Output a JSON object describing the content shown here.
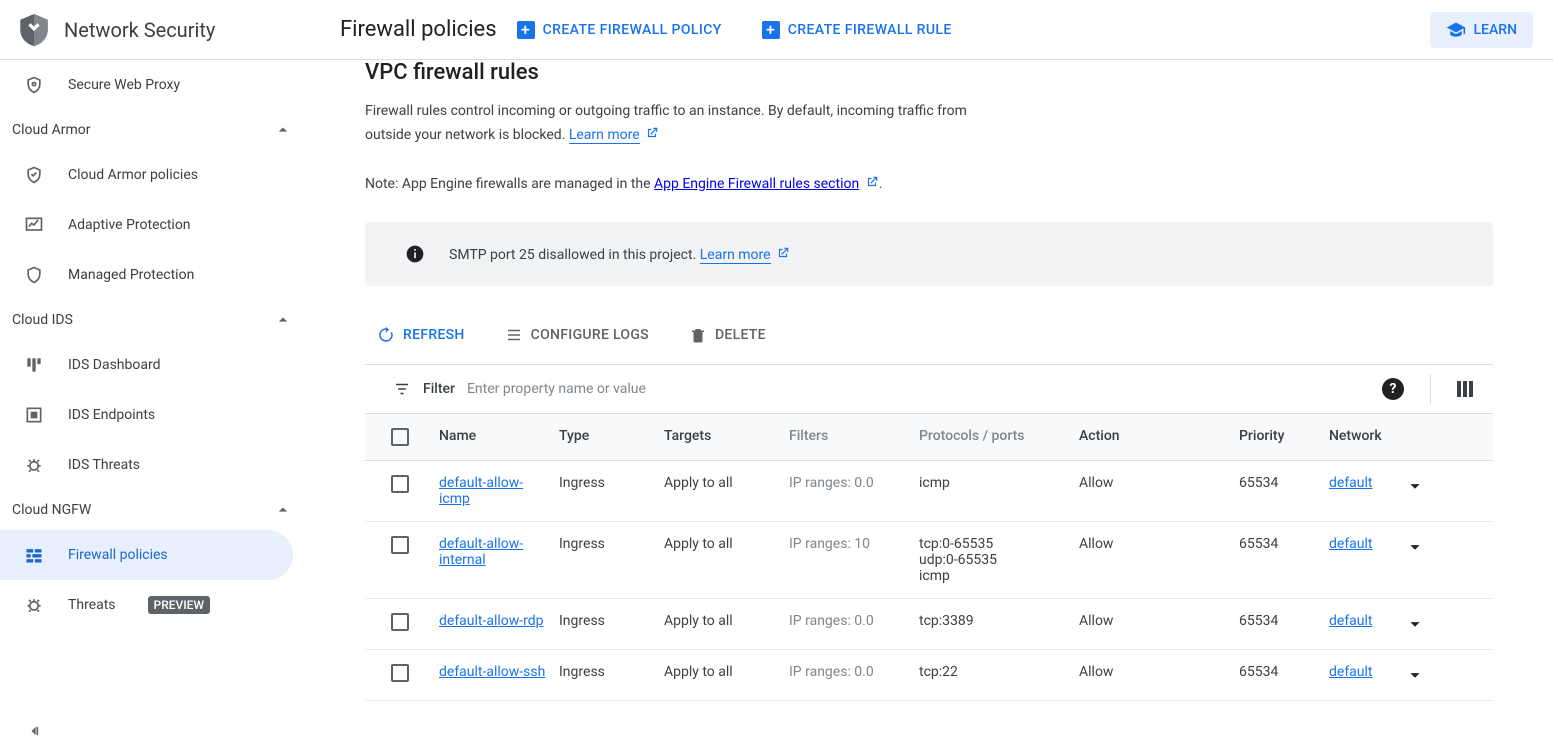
{
  "brand": {
    "title": "Network Security"
  },
  "header": {
    "page_title": "Firewall policies",
    "create_policy": "CREATE FIREWALL POLICY",
    "create_rule": "CREATE FIREWALL RULE",
    "learn": "LEARN"
  },
  "sidebar": {
    "item_proxy": "Secure Web Proxy",
    "group_armor": "Cloud Armor",
    "item_armor_policies": "Cloud Armor policies",
    "item_adaptive": "Adaptive Protection",
    "item_managed": "Managed Protection",
    "group_ids": "Cloud IDS",
    "item_ids_dashboard": "IDS Dashboard",
    "item_ids_endpoints": "IDS Endpoints",
    "item_ids_threats": "IDS Threats",
    "group_ngfw": "Cloud NGFW",
    "item_firewall_policies": "Firewall policies",
    "item_threats": "Threats",
    "badge_preview": "PREVIEW"
  },
  "main": {
    "section_title": "VPC firewall rules",
    "desc": "Firewall rules control incoming or outgoing traffic to an instance. By default, incoming traffic from outside your network is blocked. ",
    "learn_more": "Learn more",
    "note_prefix": "Note: App Engine firewalls are managed in the ",
    "note_link": "App Engine Firewall rules section",
    "smtp_msg": "SMTP port 25 disallowed in this project. ",
    "refresh": "REFRESH",
    "configure_logs": "CONFIGURE LOGS",
    "delete": "DELETE",
    "filter_label": "Filter",
    "filter_placeholder": "Enter property name or value"
  },
  "columns": {
    "name": "Name",
    "type": "Type",
    "targets": "Targets",
    "filters": "Filters",
    "protocols": "Protocols / ports",
    "action": "Action",
    "priority": "Priority",
    "network": "Network"
  },
  "rows": [
    {
      "name": "default-allow-icmp",
      "type": "Ingress",
      "targets": "Apply to all",
      "filters": "IP ranges: 0.0",
      "protocols": "icmp",
      "action": "Allow",
      "priority": "65534",
      "network": "default"
    },
    {
      "name": "default-allow-internal",
      "type": "Ingress",
      "targets": "Apply to all",
      "filters": "IP ranges: 10",
      "protocols": "tcp:0-65535\nudp:0-65535\nicmp",
      "action": "Allow",
      "priority": "65534",
      "network": "default"
    },
    {
      "name": "default-allow-rdp",
      "type": "Ingress",
      "targets": "Apply to all",
      "filters": "IP ranges: 0.0",
      "protocols": "tcp:3389",
      "action": "Allow",
      "priority": "65534",
      "network": "default"
    },
    {
      "name": "default-allow-ssh",
      "type": "Ingress",
      "targets": "Apply to all",
      "filters": "IP ranges: 0.0",
      "protocols": "tcp:22",
      "action": "Allow",
      "priority": "65534",
      "network": "default"
    }
  ]
}
